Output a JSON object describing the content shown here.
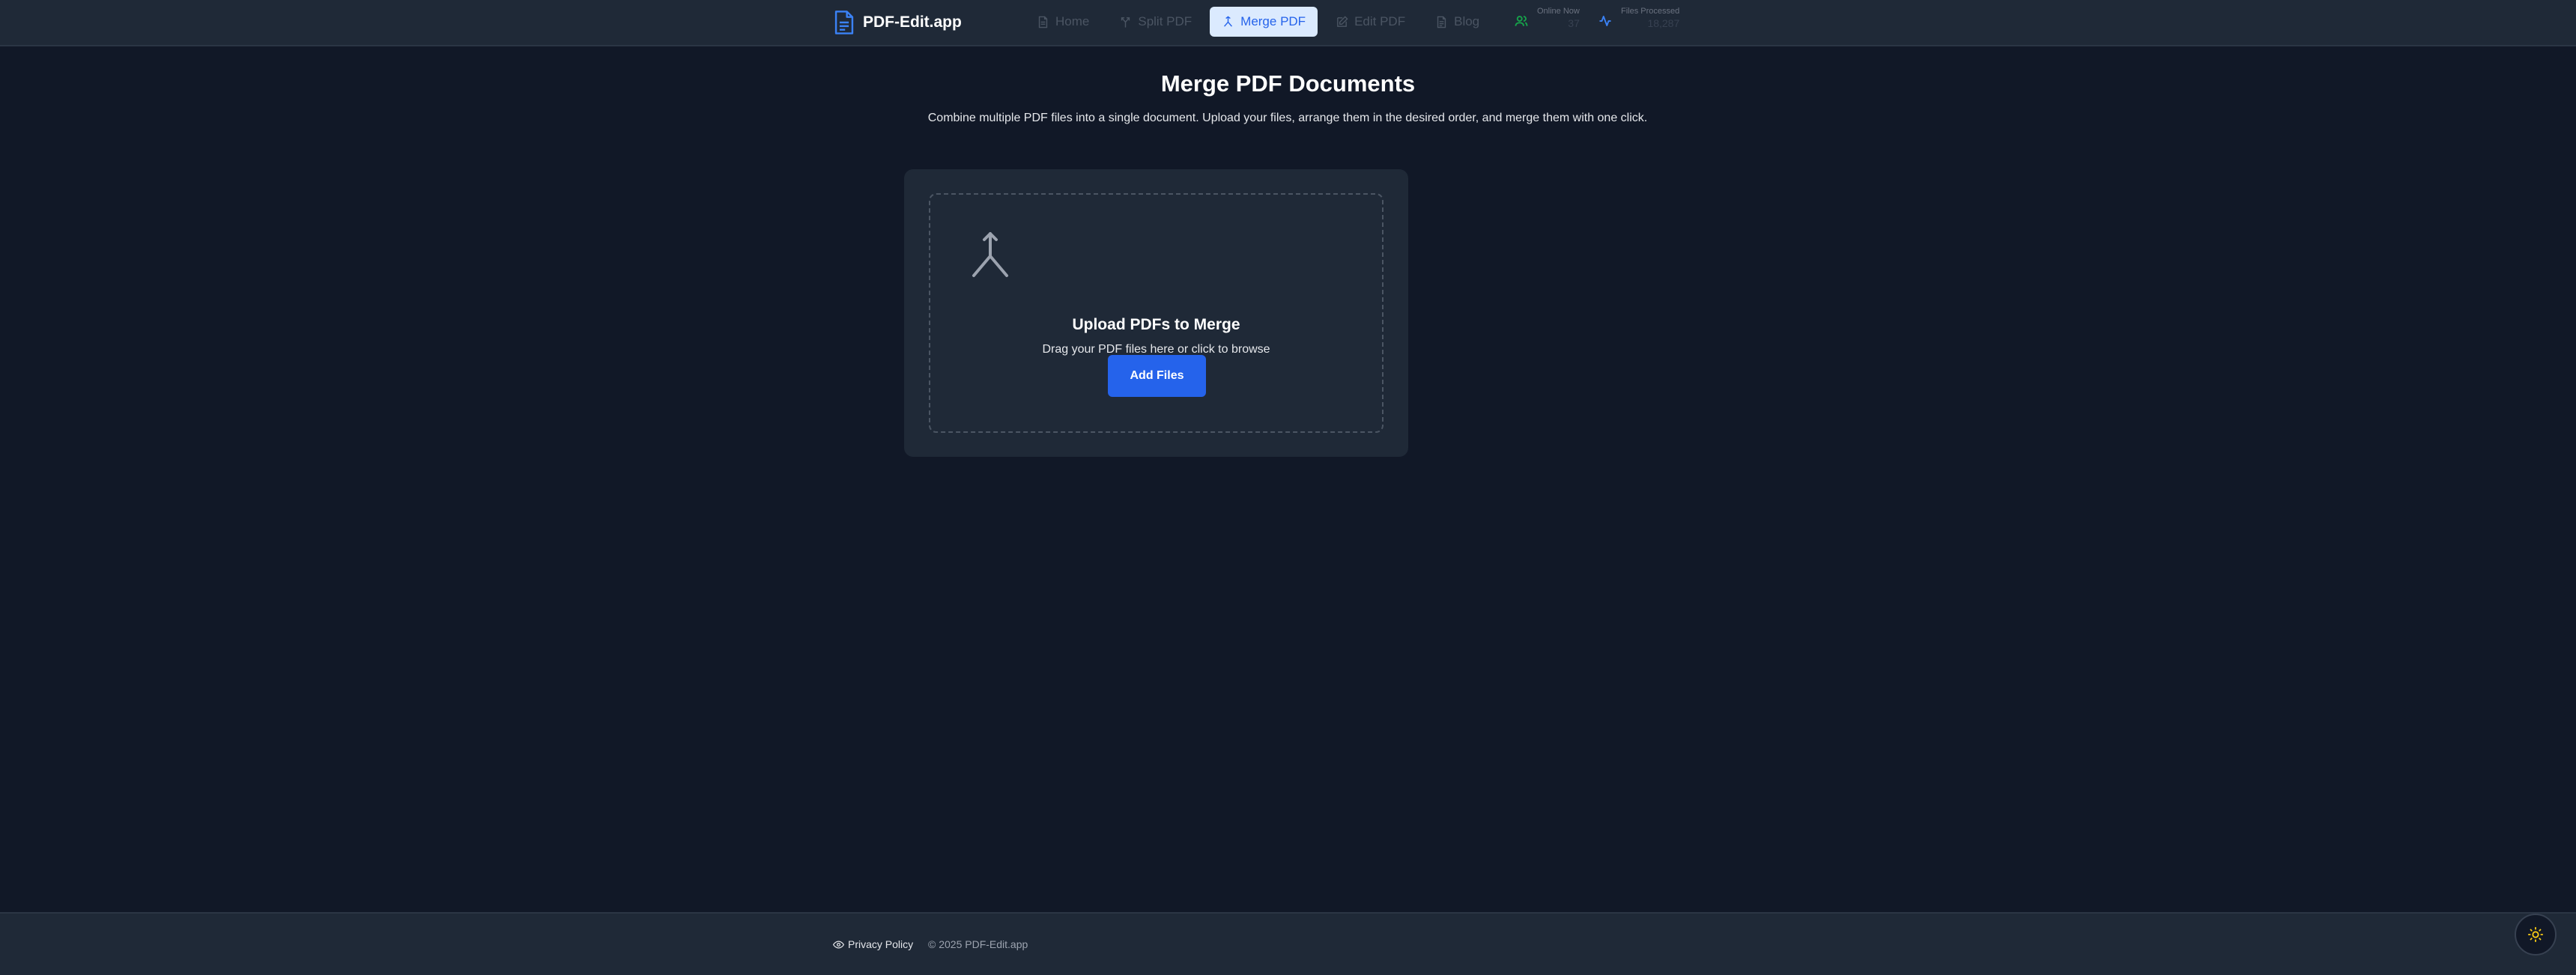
{
  "header": {
    "brand": "PDF-Edit.app",
    "nav": [
      {
        "label": "Home",
        "icon": "file-icon"
      },
      {
        "label": "Split PDF",
        "icon": "split-icon"
      },
      {
        "label": "Merge PDF",
        "icon": "merge-icon",
        "active": true
      },
      {
        "label": "Edit PDF",
        "icon": "edit-icon"
      },
      {
        "label": "Blog",
        "icon": "file-text-icon"
      }
    ],
    "stats": {
      "online_label": "Online Now",
      "online_value": "37",
      "processed_label": "Files Processed",
      "processed_value": "18,287"
    }
  },
  "main": {
    "title": "Merge PDF Documents",
    "description": "Combine multiple PDF files into a single document. Upload your files, arrange them in the desired order, and merge them with one click.",
    "upload": {
      "title": "Upload PDFs to Merge",
      "subtitle": "Drag your PDF files here or click to browse",
      "button": "Add Files"
    }
  },
  "footer": {
    "privacy": "Privacy Policy",
    "copyright": "© 2025 PDF-Edit.app"
  },
  "colors": {
    "background": "#111827",
    "surface": "#1f2937",
    "accent": "#2563eb",
    "active_tab_bg": "#dbeafe",
    "online_green": "#16a34a",
    "theme_icon": "#facc15"
  }
}
